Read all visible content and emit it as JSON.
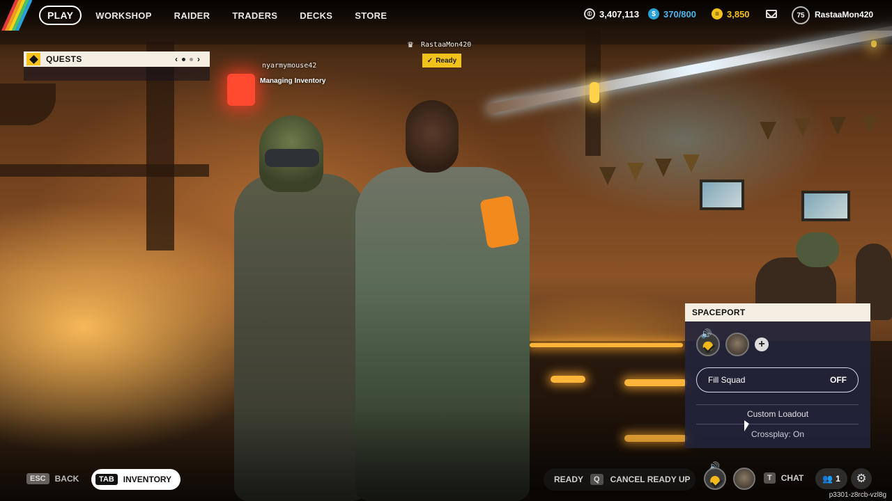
{
  "nav": {
    "play": "PLAY",
    "workshop": "WORKSHOP",
    "raider": "RAIDER",
    "traders": "TRADERS",
    "decks": "DECKS",
    "store": "STORE"
  },
  "currencies": {
    "coins": "3,407,113",
    "raider_tokens": "370/800",
    "credits": "3,850"
  },
  "player": {
    "level": "75",
    "username": "RastaaMon420"
  },
  "quests": {
    "title": "QUESTS",
    "prev": "‹",
    "next": "›"
  },
  "players_in_scene": [
    {
      "name": "nyarmymouse42",
      "status": "Managing Inventory"
    },
    {
      "name": "RastaaMon420",
      "status": "Ready"
    }
  ],
  "spaceport": {
    "title": "SPACEPORT",
    "fill_squad_label": "Fill Squad",
    "fill_squad_state": "OFF",
    "custom_loadout": "Custom Loadout",
    "crossplay": "Crossplay: On"
  },
  "bottom": {
    "back_key": "ESC",
    "back_label": "BACK",
    "inventory_key": "TAB",
    "inventory_label": "INVENTORY",
    "ready_label": "READY",
    "cancel_key": "Q",
    "cancel_label": "CANCEL READY UP",
    "chat_key": "T",
    "chat_label": "CHAT",
    "friends_count": "1",
    "session_id": "p3301-z8rcb-vzl8g"
  },
  "colors": {
    "accent_yellow": "#f2c21c",
    "panel_light": "#f4efe2",
    "panel_dark": "#22243e",
    "raider_token_blue": "#2aa0d8"
  },
  "icons": {
    "coins": "coin-icon",
    "raider_tokens": "raider-token-icon",
    "credits": "credits-icon",
    "mail": "mail-icon",
    "settings": "gear-icon",
    "friends": "friends-icon"
  }
}
